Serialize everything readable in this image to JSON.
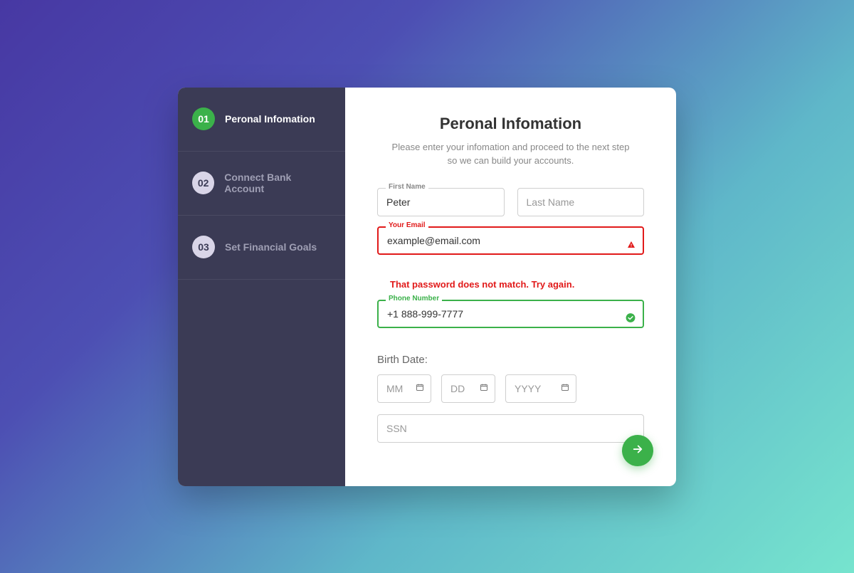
{
  "sidebar": {
    "steps": [
      {
        "num": "01",
        "label": "Peronal Infomation"
      },
      {
        "num": "02",
        "label": "Connect Bank Account"
      },
      {
        "num": "03",
        "label": "Set Financial Goals"
      }
    ]
  },
  "main": {
    "title": "Peronal Infomation",
    "subtitle": "Please enter your infomation and proceed to the next step so we can build your accounts.",
    "first_name_label": "First Name",
    "first_name_value": "Peter",
    "last_name_placeholder": "Last Name",
    "email_label": "Your Email",
    "email_value": "example@email.com",
    "email_error": "That password does not match. Try again.",
    "phone_label": "Phone Number",
    "phone_value": "+1 888-999-7777",
    "birth_date_label": "Birth Date:",
    "mm_placeholder": "MM",
    "dd_placeholder": "DD",
    "yyyy_placeholder": "YYYY",
    "ssn_placeholder": "SSN"
  },
  "colors": {
    "accent": "#3bb14a",
    "error": "#e11a1a",
    "sidebar_bg": "#3b3b55"
  }
}
